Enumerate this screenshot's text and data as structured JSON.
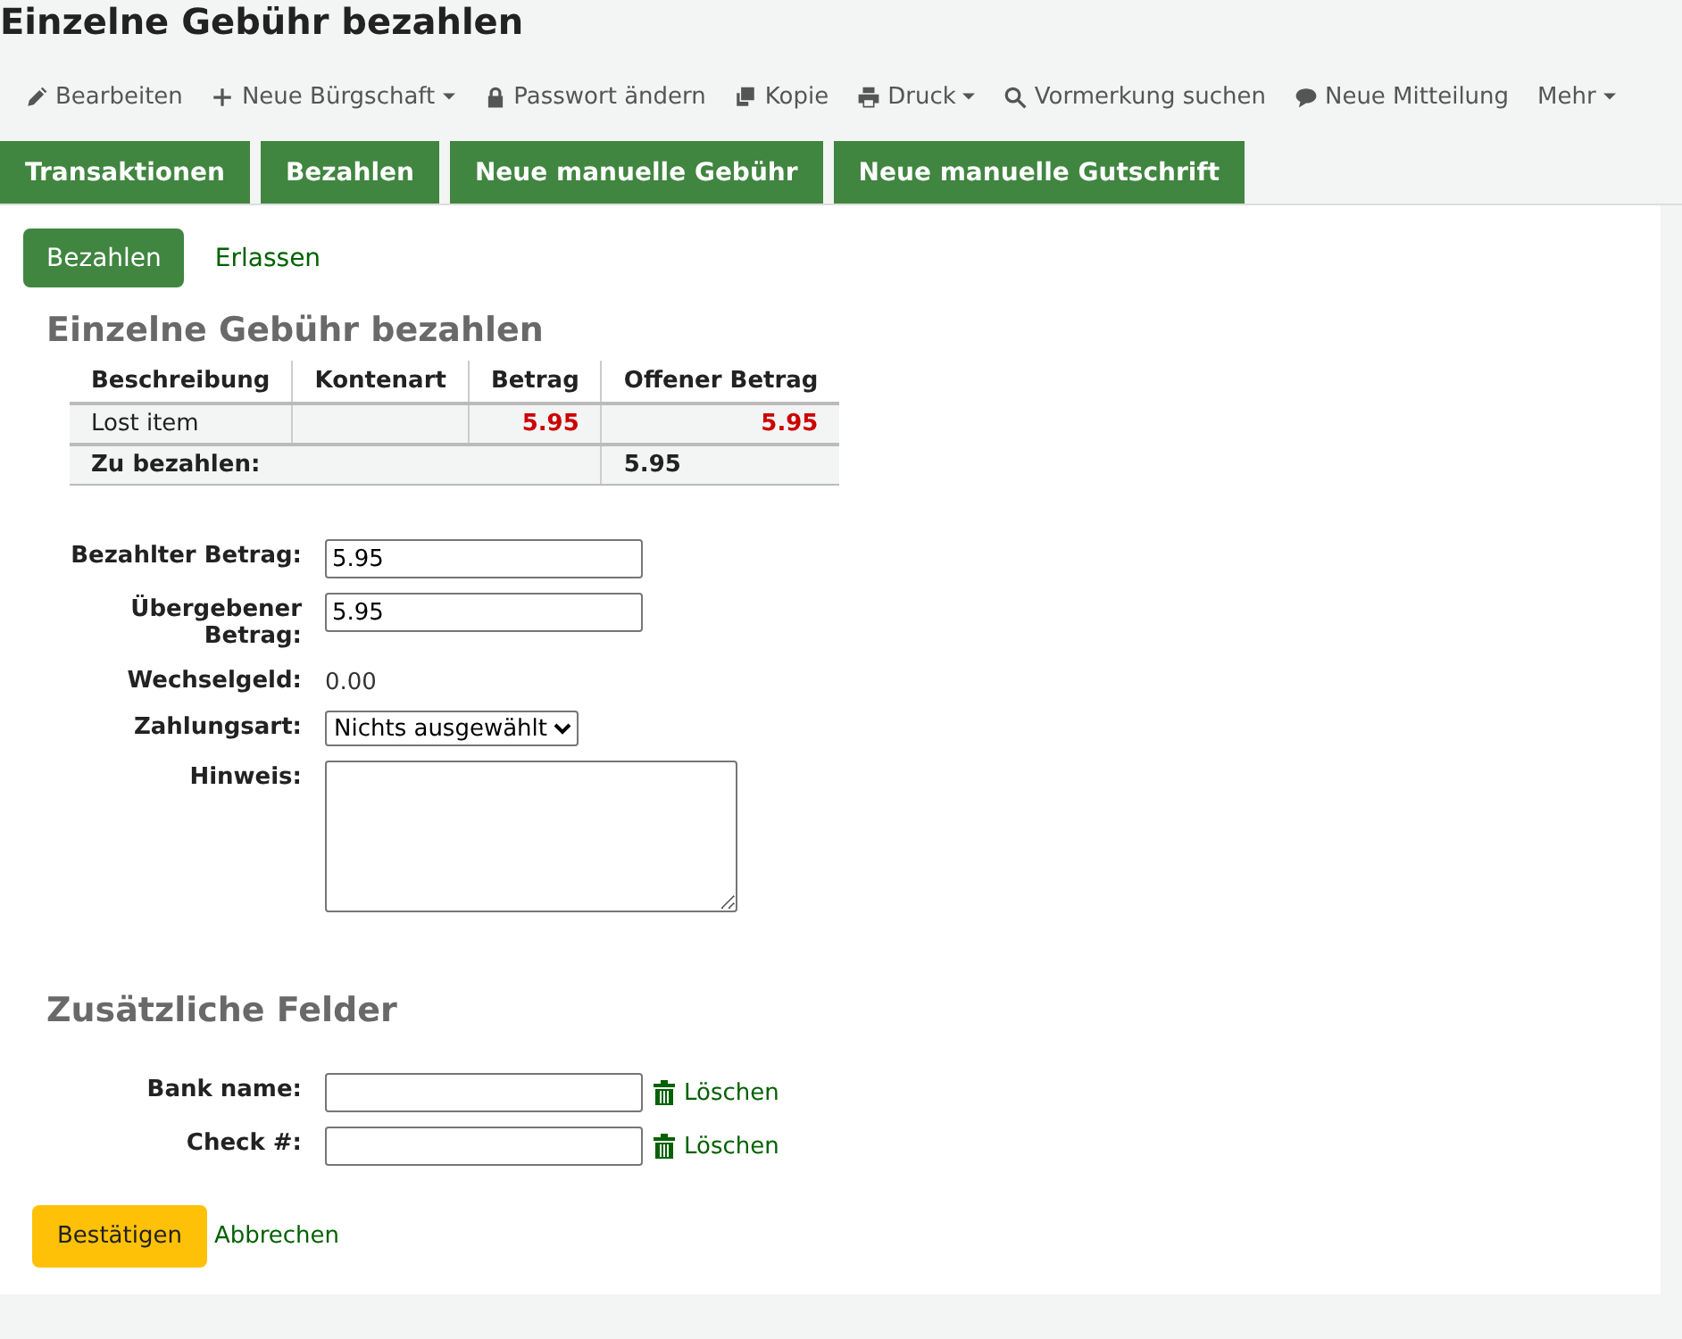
{
  "title": "Einzelne Gebühr bezahlen",
  "toolbar": [
    {
      "label": "Bearbeiten",
      "dropdown": false
    },
    {
      "label": "Neue Bürgschaft",
      "dropdown": true
    },
    {
      "label": "Passwort ändern",
      "dropdown": false
    },
    {
      "label": "Kopie",
      "dropdown": false
    },
    {
      "label": "Druck",
      "dropdown": true
    },
    {
      "label": "Vormerkung suchen",
      "dropdown": false
    },
    {
      "label": "Neue Mitteilung",
      "dropdown": false
    },
    {
      "label": "Mehr",
      "dropdown": true
    }
  ],
  "tabs": [
    "Transaktionen",
    "Bezahlen",
    "Neue manuelle Gebühr",
    "Neue manuelle Gutschrift"
  ],
  "subtabs": [
    {
      "label": "Bezahlen",
      "selected": true
    },
    {
      "label": "Erlassen",
      "selected": false
    }
  ],
  "heading": "Einzelne Gebühr bezahlen",
  "table": {
    "columns": [
      "Beschreibung",
      "Kontenart",
      "Betrag",
      "Offener Betrag"
    ],
    "rows": [
      [
        "Lost item",
        "",
        "5.95",
        "5.95"
      ]
    ],
    "total_label": "Zu bezahlen:",
    "total": "5.95"
  },
  "form": [
    {
      "kind": "input",
      "label": "Bezahlter Betrag:",
      "value": "5.95"
    },
    {
      "kind": "input",
      "label": "Übergebener Betrag:",
      "value": "5.95"
    },
    {
      "kind": "text",
      "label": "Wechselgeld:",
      "value": "0.00"
    },
    {
      "kind": "select",
      "label": "Zahlungsart:",
      "value": "Nichts ausgewählt"
    },
    {
      "kind": "textarea",
      "label": "Hinweis:"
    }
  ],
  "extra_heading": "Zusätzliche Felder",
  "extra_fields": [
    {
      "label": "Bank name:",
      "action": "Löschen"
    },
    {
      "label": "Check #:",
      "action": "Löschen"
    }
  ],
  "buttons": {
    "confirm": "Bestätigen",
    "cancel": "Abbrechen"
  }
}
